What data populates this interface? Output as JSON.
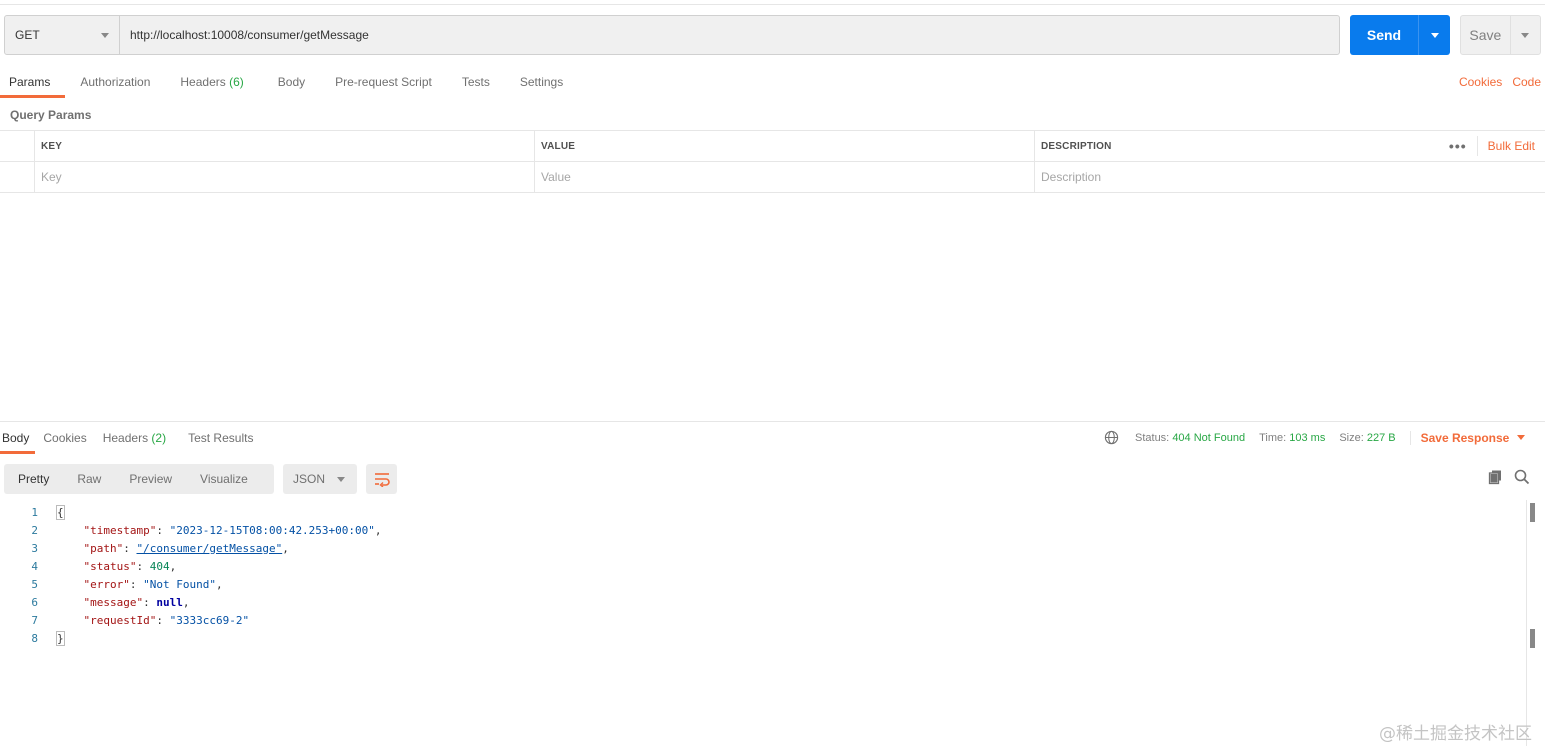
{
  "request": {
    "method": "GET",
    "url": "http://localhost:10008/consumer/getMessage",
    "send_label": "Send",
    "save_label": "Save"
  },
  "request_tabs": [
    {
      "label": "Params",
      "active": true
    },
    {
      "label": "Authorization"
    },
    {
      "label": "Headers",
      "count": "(6)"
    },
    {
      "label": "Body"
    },
    {
      "label": "Pre-request Script"
    },
    {
      "label": "Tests"
    },
    {
      "label": "Settings"
    }
  ],
  "right_links": {
    "cookies": "Cookies",
    "code": "Code"
  },
  "query_params": {
    "title": "Query Params",
    "headers": {
      "key": "KEY",
      "value": "VALUE",
      "description": "DESCRIPTION"
    },
    "more_icon": "more-horizontal-icon",
    "bulk_edit": "Bulk Edit",
    "placeholders": {
      "key": "Key",
      "value": "Value",
      "description": "Description"
    }
  },
  "response_tabs": [
    {
      "label": "Body",
      "active": true
    },
    {
      "label": "Cookies"
    },
    {
      "label": "Headers",
      "count": "(2)"
    },
    {
      "label": "Test Results"
    }
  ],
  "response_status": {
    "globe_icon": "globe-icon",
    "status_label": "Status:",
    "status_value": "404 Not Found",
    "time_label": "Time:",
    "time_value": "103 ms",
    "size_label": "Size:",
    "size_value": "227 B",
    "save_response": "Save Response"
  },
  "view": {
    "modes": [
      "Pretty",
      "Raw",
      "Preview",
      "Visualize"
    ],
    "active_mode": "Pretty",
    "format": "JSON",
    "wrap_icon": "wrap-lines-icon",
    "copy_icon": "copy-icon",
    "search_icon": "search-icon"
  },
  "response_body": {
    "line_numbers": [
      "1",
      "2",
      "3",
      "4",
      "5",
      "6",
      "7",
      "8"
    ],
    "open_brace": "{",
    "close_brace": "}",
    "fields": [
      {
        "key": "\"timestamp\"",
        "value": "\"2023-12-15T08:00:42.253+00:00\"",
        "trail": ","
      },
      {
        "key": "\"path\"",
        "value": "\"/consumer/getMessage\"",
        "trail": ","
      },
      {
        "key": "\"status\"",
        "value": "404",
        "trail": ","
      },
      {
        "key": "\"error\"",
        "value": "\"Not Found\"",
        "trail": ","
      },
      {
        "key": "\"message\"",
        "value": "null",
        "trail": ","
      },
      {
        "key": "\"requestId\"",
        "value": "\"3333cc69-2\"",
        "trail": ""
      }
    ]
  },
  "watermark": "@稀土掘金技术社区",
  "colors": {
    "accent": "#f26b3a",
    "send": "#097bed",
    "success": "#28a745"
  }
}
